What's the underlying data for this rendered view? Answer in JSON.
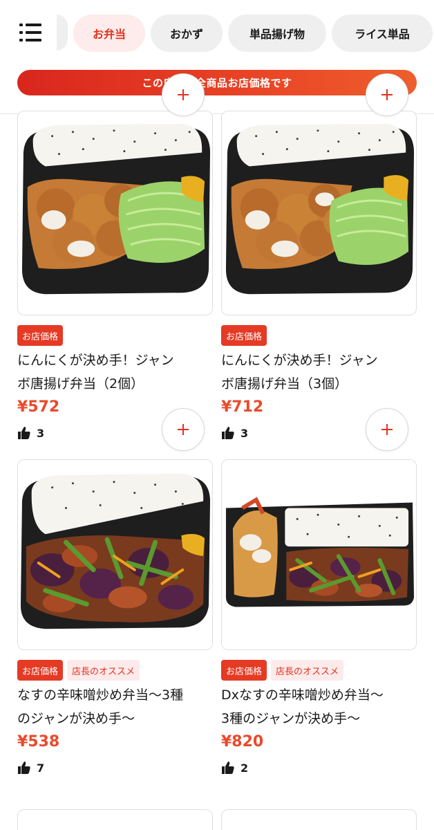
{
  "nav": {
    "menu_icon": "hamburger-menu-icon",
    "tabs": [
      {
        "label": "お弁当",
        "active": true
      },
      {
        "label": "おかず",
        "active": false
      },
      {
        "label": "単品揚げ物",
        "active": false
      },
      {
        "label": "ライス単品",
        "active": false
      }
    ]
  },
  "banner": {
    "text": "この店舗は全商品お店価格です"
  },
  "colors": {
    "accent": "#e0321f",
    "price": "#e94a2b",
    "badge_bg": "#e53a24",
    "reco_bg": "#fdeaea"
  },
  "products": [
    {
      "badges": [
        "お店価格"
      ],
      "name_line1": "にんにくが決め手！ジャン",
      "name_line2": "ボ唐揚げ弁当（2個）",
      "price": "¥572",
      "likes": "3",
      "image": "karaage-bento-photo"
    },
    {
      "badges": [
        "お店価格"
      ],
      "name_line1": "にんにくが決め手！ジャン",
      "name_line2": "ボ唐揚げ弁当（3個）",
      "price": "¥712",
      "likes": "3",
      "image": "karaage-bento-photo"
    },
    {
      "badges": [
        "お店価格",
        "店長のオススメ"
      ],
      "name_line1": "なすの辛味噌炒め弁当〜3種",
      "name_line2": "のジャンが決め手〜",
      "price": "¥538",
      "likes": "7",
      "image": "eggplant-bento-photo"
    },
    {
      "badges": [
        "お店価格",
        "店長のオススメ"
      ],
      "name_line1": "Dxなすの辛味噌炒め弁当〜",
      "name_line2": "3種のジャンが決め手〜",
      "price": "¥820",
      "likes": "2",
      "image": "dx-eggplant-bento-photo"
    }
  ]
}
